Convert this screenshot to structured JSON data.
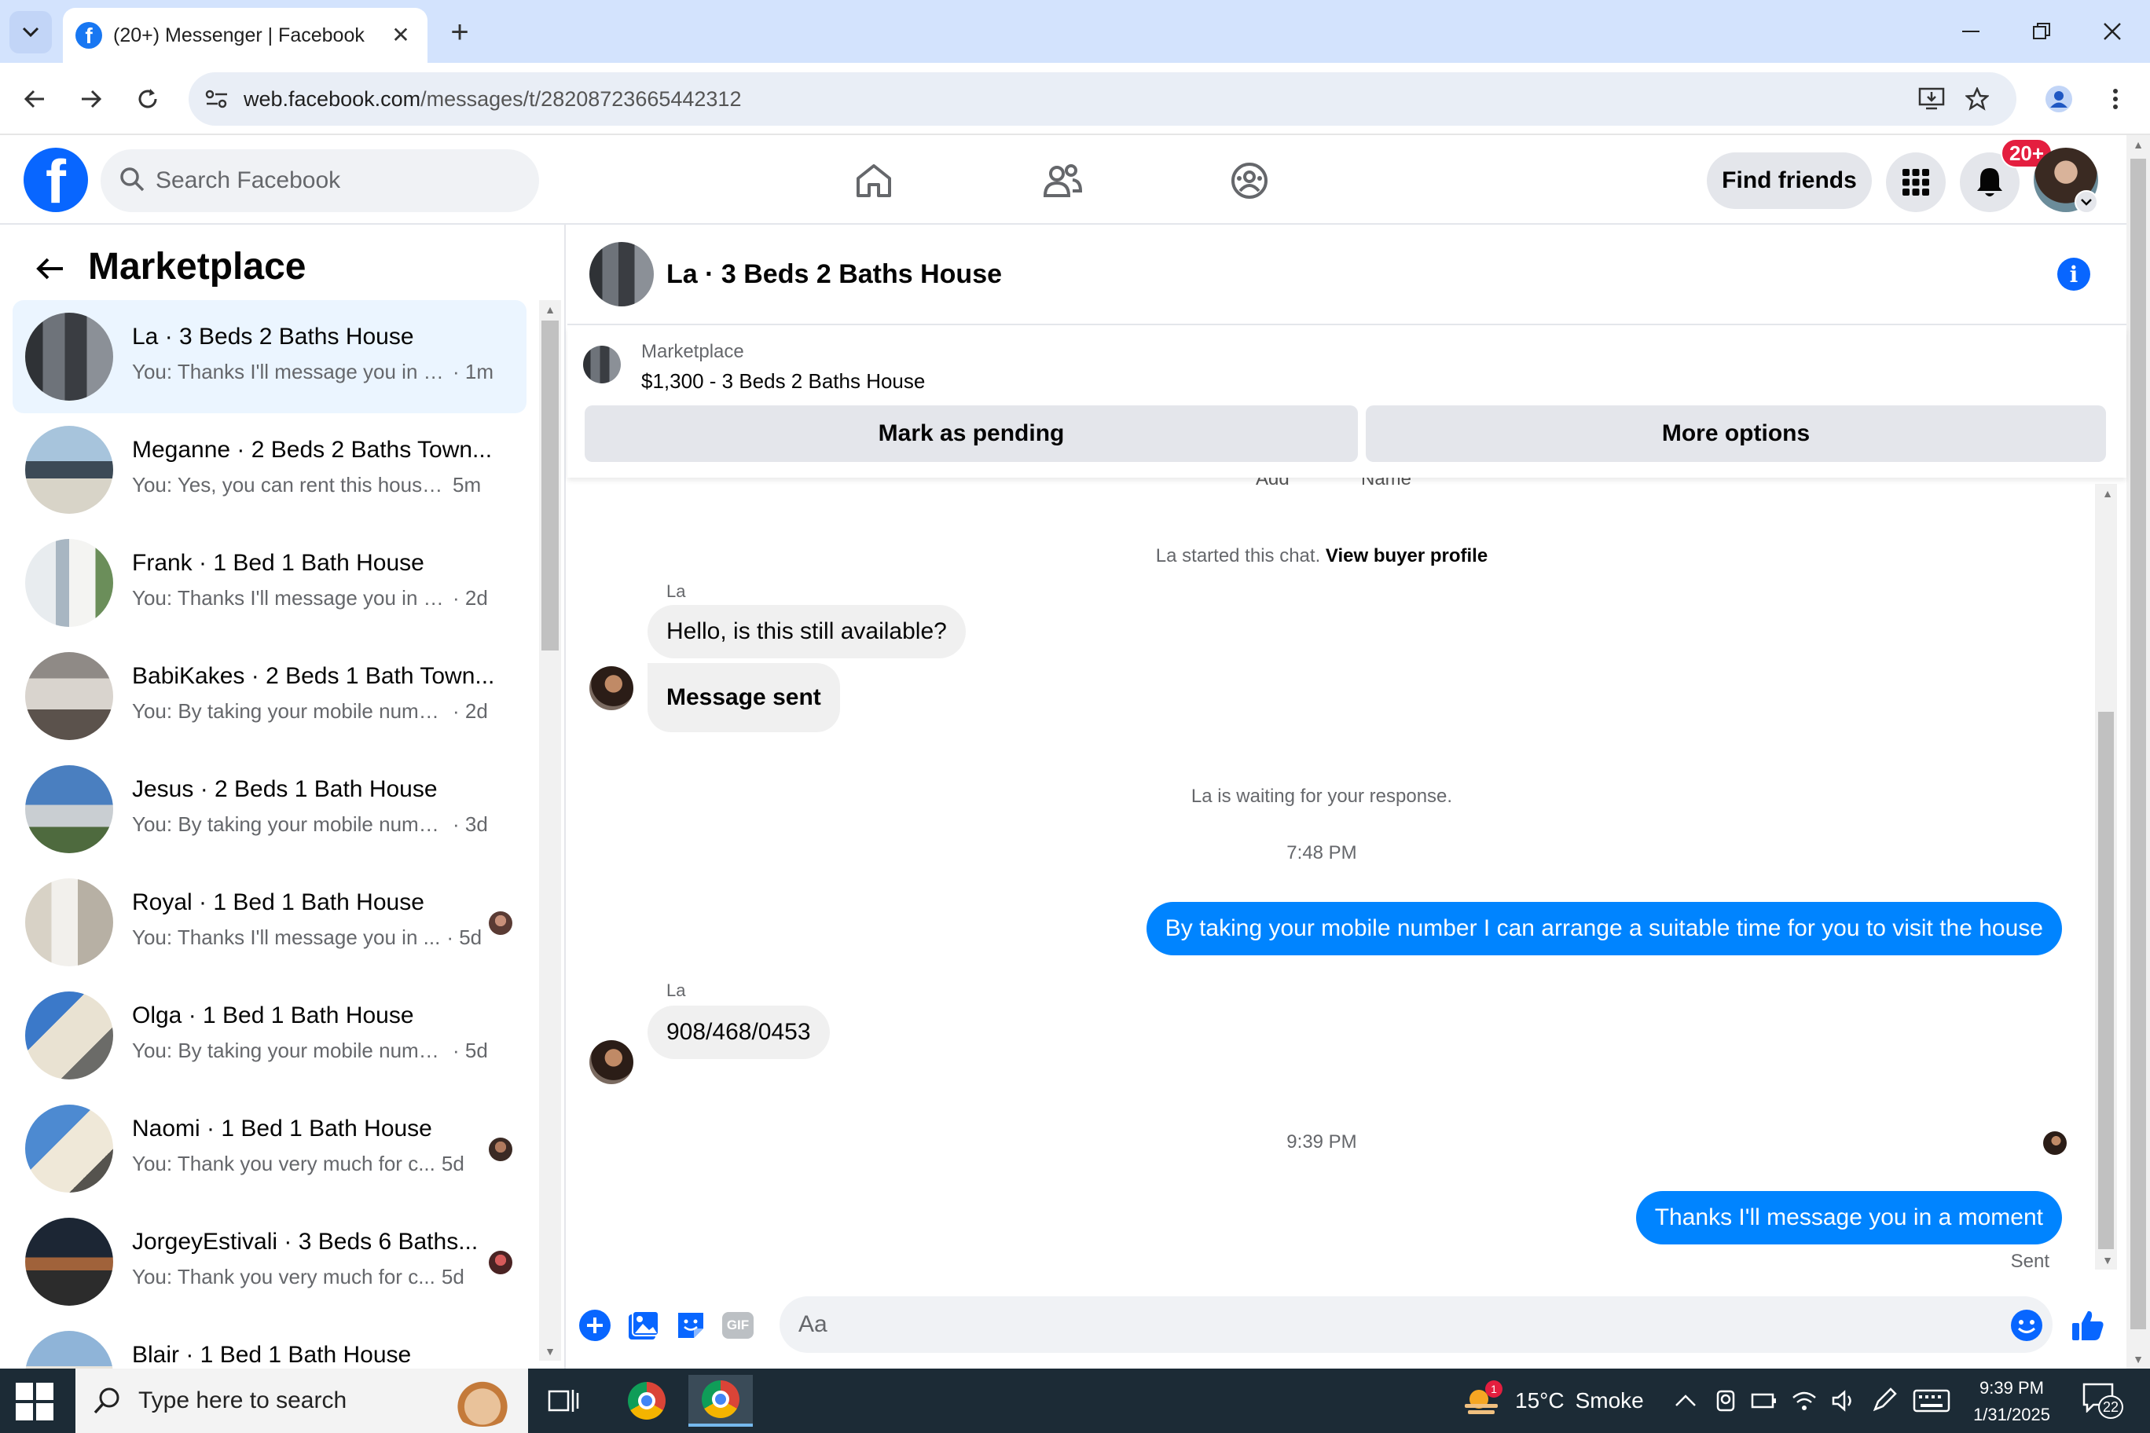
{
  "browser": {
    "tab_title": "(20+) Messenger | Facebook",
    "url_host": "web.facebook.com",
    "url_path": "/messages/t/28208723665442312"
  },
  "facebook": {
    "search_placeholder": "Search Facebook",
    "find_friends_label": "Find friends",
    "notification_badge": "20+"
  },
  "sidebar": {
    "title": "Marketplace",
    "conversations": [
      {
        "name": "La · 3 Beds 2 Baths House",
        "preview": "You: Thanks I'll message you in a ...",
        "time": "· 1m",
        "active": true
      },
      {
        "name": "Meganne · 2 Beds 2 Baths Town...",
        "preview": "You: Yes, you can rent this house. F...",
        "time": "5m"
      },
      {
        "name": "Frank · 1 Bed 1 Bath House",
        "preview": "You: Thanks I'll message you in a ...",
        "time": "· 2d"
      },
      {
        "name": "BabiKakes · 2 Beds 1 Bath Town...",
        "preview": "You: By taking your mobile number...",
        "time": "· 2d"
      },
      {
        "name": "Jesus · 2 Beds 1 Bath House",
        "preview": "You: By taking your mobile number...",
        "time": "· 3d"
      },
      {
        "name": "Royal · 1 Bed 1 Bath House",
        "preview": "You: Thanks I'll message you in ...",
        "time": "· 5d"
      },
      {
        "name": "Olga · 1 Bed 1 Bath House",
        "preview": "You: By taking your mobile number...",
        "time": "· 5d"
      },
      {
        "name": "Naomi · 1 Bed 1 Bath House",
        "preview": "You: Thank you very much for c...",
        "time": "5d"
      },
      {
        "name": "JorgeyEstivali · 3 Beds 6 Baths...",
        "preview": "You: Thank you very much for c...",
        "time": "5d"
      },
      {
        "name": "Blair · 1 Bed 1 Bath House",
        "preview": "",
        "time": ""
      }
    ]
  },
  "chat": {
    "title": "La · 3 Beds 2 Baths House",
    "listing_label": "Marketplace",
    "listing_price": "$1,300 - 3 Beds 2 Baths House",
    "mark_pending_label": "Mark as pending",
    "more_options_label": "More options",
    "faded_left": "Add",
    "faded_right": "Name",
    "started_text": "La started this chat.",
    "view_profile_link": "View buyer profile",
    "sender_name": "La",
    "msg_1": "Hello, is this still available?",
    "msg_2": "Message sent",
    "waiting_text": "La is waiting for your response.",
    "time_1": "7:48 PM",
    "msg_3": "By taking your mobile number I can arrange a suitable time for you to visit the house",
    "msg_4": "908/468/0453",
    "time_2": "9:39 PM",
    "msg_5": "Thanks I'll message you in a moment",
    "sent_status": "Sent",
    "input_placeholder": "Aa",
    "gif_label": "GIF"
  },
  "taskbar": {
    "search_placeholder": "Type here to search",
    "weather_temp": "15°C",
    "weather_desc": "Smoke",
    "weather_badge": "1",
    "time": "9:39 PM",
    "date": "1/31/2025",
    "notification_count": "22"
  },
  "colors": {
    "fb_blue": "#0866ff",
    "messenger_blue": "#0084ff",
    "active_row": "#ebf5ff",
    "badge_red": "#e41e3f"
  }
}
